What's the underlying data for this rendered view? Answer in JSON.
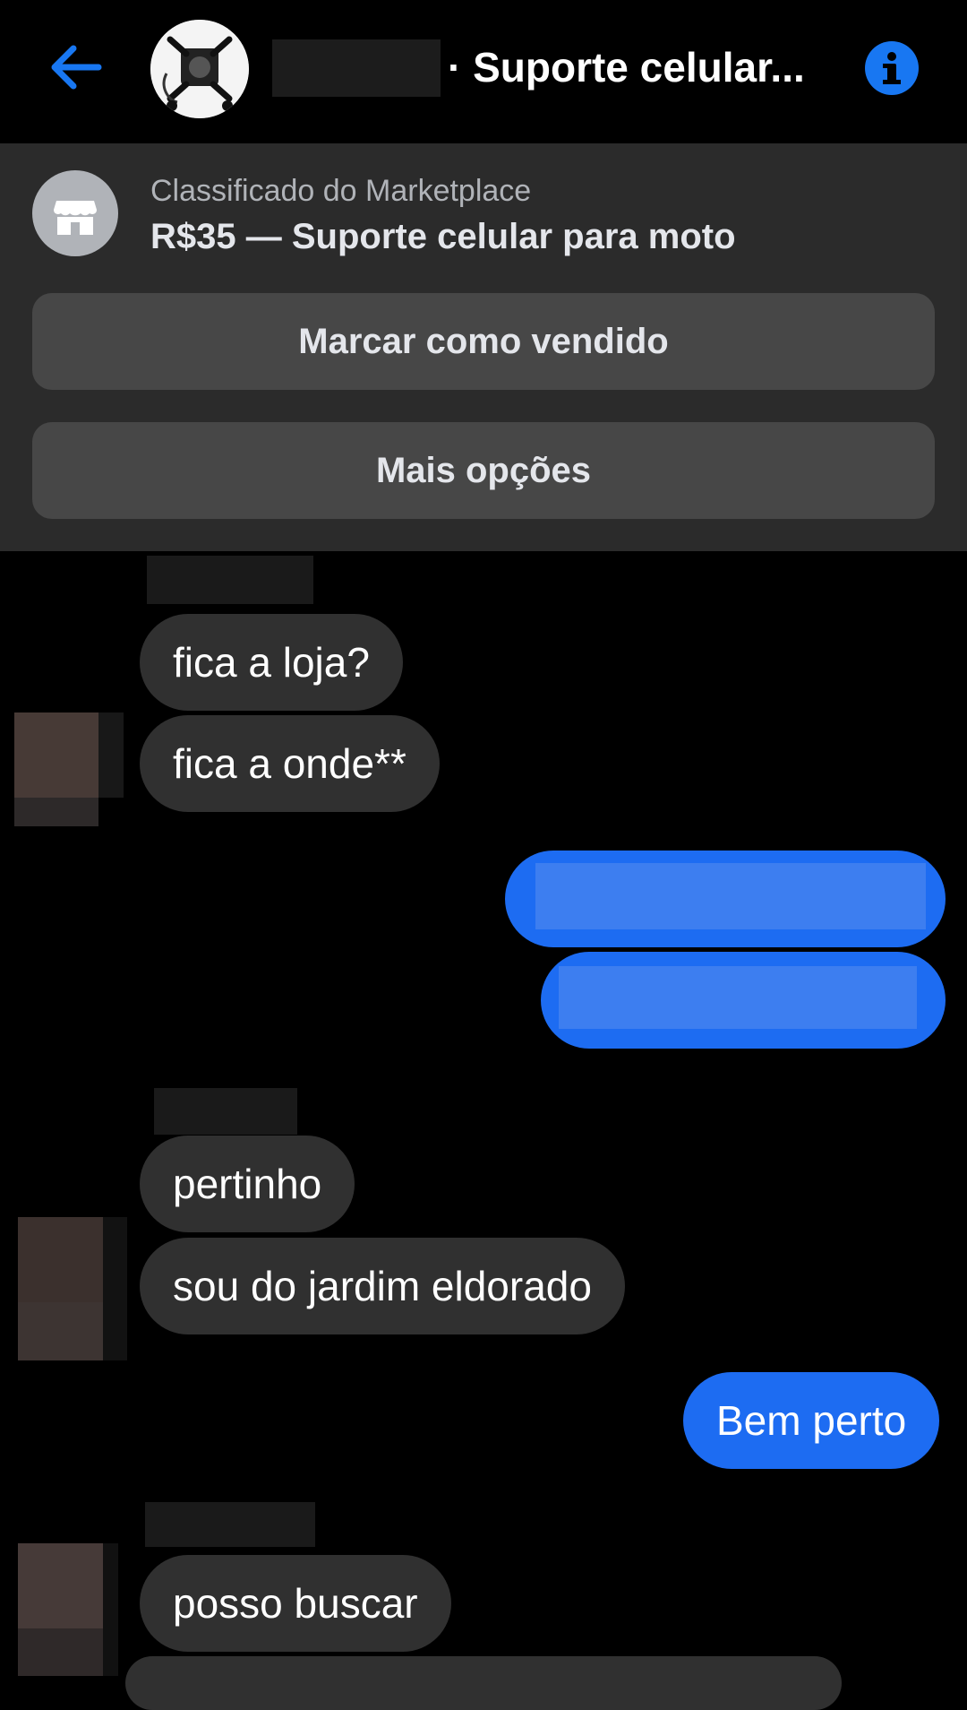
{
  "header": {
    "back_icon": "arrow-left-icon",
    "title": "· Suporte celular...",
    "info_icon": "info-icon",
    "accent": "#1877f2"
  },
  "marketplace": {
    "icon": "storefront-icon",
    "label": "Classificado do Marketplace",
    "item": "R$35 — Suporte celular para moto",
    "mark_sold": "Marcar como vendido",
    "more_options": "Mais opções"
  },
  "messages": [
    {
      "from": "other",
      "text": "fica a loja?"
    },
    {
      "from": "other",
      "text": "fica a onde**"
    },
    {
      "from": "me",
      "text": ""
    },
    {
      "from": "me",
      "text": ""
    },
    {
      "from": "other",
      "text": "pertinho"
    },
    {
      "from": "other",
      "text": "sou do jardim eldorado"
    },
    {
      "from": "me",
      "text": "Bem perto"
    },
    {
      "from": "other",
      "text": "posso buscar"
    }
  ],
  "colors": {
    "incoming_bubble": "#303030",
    "outgoing_bubble": "#1d6cf2",
    "panel": "#2b2b2b",
    "panel_button": "#474747"
  }
}
